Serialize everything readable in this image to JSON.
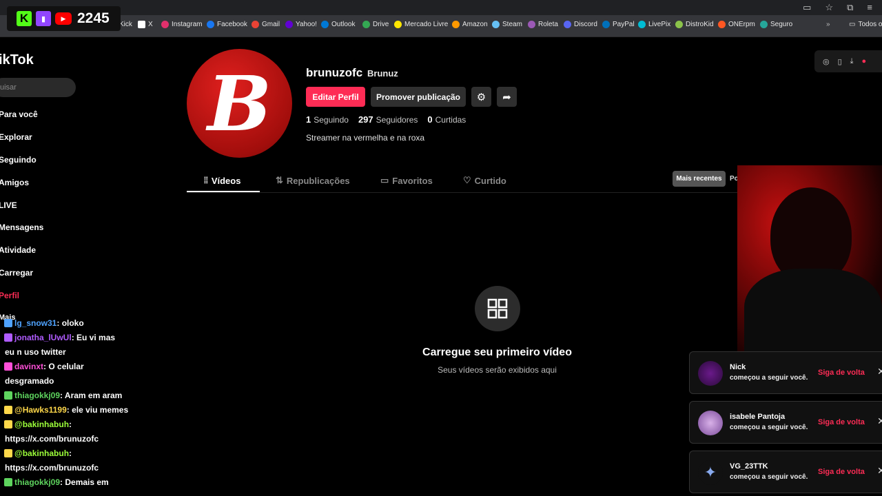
{
  "overlay": {
    "viewer_count": "2245"
  },
  "bookmarks": [
    {
      "label": "Kick",
      "color": "#53fc18"
    },
    {
      "label": "X",
      "color": "#ffffff"
    },
    {
      "label": "Instagram",
      "color": "#e1306c"
    },
    {
      "label": "Facebook",
      "color": "#1877f2"
    },
    {
      "label": "Gmail",
      "color": "#ea4335"
    },
    {
      "label": "Yahoo!",
      "color": "#6001d2"
    },
    {
      "label": "Outlook",
      "color": "#0078d4"
    },
    {
      "label": "Drive",
      "color": "#34a853"
    },
    {
      "label": "Mercado Livre",
      "color": "#ffe600"
    },
    {
      "label": "Amazon",
      "color": "#ff9900"
    },
    {
      "label": "Steam",
      "color": "#66c0f4"
    },
    {
      "label": "Roleta",
      "color": "#9b59b6"
    },
    {
      "label": "Discord",
      "color": "#5865f2"
    },
    {
      "label": "PayPal",
      "color": "#0070ba"
    },
    {
      "label": "LivePix",
      "color": "#00bcd4"
    },
    {
      "label": "DistroKid",
      "color": "#8bc34a"
    },
    {
      "label": "ONErpm",
      "color": "#ff5722"
    },
    {
      "label": "Seguro",
      "color": "#26a69a"
    },
    {
      "label": "Todos o",
      "color": "#cccccc"
    }
  ],
  "sidebar": {
    "logo": "ikTok",
    "search_placeholder": "uisar",
    "items": [
      {
        "label": "Para você"
      },
      {
        "label": "Explorar"
      },
      {
        "label": "Seguindo"
      },
      {
        "label": "Amigos"
      },
      {
        "label": "LIVE"
      },
      {
        "label": "Mensagens"
      },
      {
        "label": "Atividade"
      },
      {
        "label": "Carregar"
      },
      {
        "label": "Perfil"
      },
      {
        "label": "Mais"
      }
    ]
  },
  "profile": {
    "username": "brunuzofc",
    "nickname": "Brunuz",
    "edit_label": "Editar Perfil",
    "promote_label": "Promover publicação",
    "stats": [
      {
        "value": "1",
        "label": "Seguindo"
      },
      {
        "value": "297",
        "label": "Seguidores"
      },
      {
        "value": "0",
        "label": "Curtidas"
      }
    ],
    "bio": "Streamer na vermelha e na roxa"
  },
  "tabs": [
    {
      "label": "Vídeos"
    },
    {
      "label": "Republicações"
    },
    {
      "label": "Favoritos"
    },
    {
      "label": "Curtido"
    }
  ],
  "sort": {
    "active": "Mais recentes",
    "other": "Po"
  },
  "empty_state": {
    "title": "Carregue seu primeiro vídeo",
    "subtitle": "Seus vídeos serão exibidos aqui"
  },
  "chat": [
    {
      "user": "lg_snow31",
      "user_color": "#4fa3ff",
      "message": ": oloko"
    },
    {
      "user": "jonatha_lUwUl",
      "user_color": "#b05cff",
      "message": ": Eu vi mas"
    },
    {
      "user": "",
      "user_color": "#ffffff",
      "message": "eu n uso twitter"
    },
    {
      "user": "davinxt",
      "user_color": "#ff4fd8",
      "message": ": O celular"
    },
    {
      "user": "",
      "user_color": "#ffffff",
      "message": "desgramado"
    },
    {
      "user": "thiagokkj09",
      "user_color": "#5ed45e",
      "message": ": Aram em aram"
    },
    {
      "user": "@Hawks1199",
      "user_color": "#ffd84a",
      "message": ": ele viu memes"
    },
    {
      "user": "@bakinhabuh",
      "user_color": "#9dff3a",
      "message": ":"
    },
    {
      "user": "",
      "user_color": "#ffffff",
      "message": "https://x.com/brunuzofc"
    },
    {
      "user": "@bakinhabuh",
      "user_color": "#9dff3a",
      "message": ":"
    },
    {
      "user": "",
      "user_color": "#ffffff",
      "message": "https://x.com/brunuzofc"
    },
    {
      "user": "thiagokkj09",
      "user_color": "#5ed45e",
      "message": ": Demais em"
    }
  ],
  "notifications": [
    {
      "name": "Nick",
      "text": "começou a seguir você.",
      "action": "Siga de volta"
    },
    {
      "name": "isabele Pantoja",
      "text": "começou a seguir você.",
      "action": "Siga de volta"
    },
    {
      "name": "VG_23TTK",
      "text": "começou a seguir você.",
      "action": "Siga de volta"
    }
  ]
}
